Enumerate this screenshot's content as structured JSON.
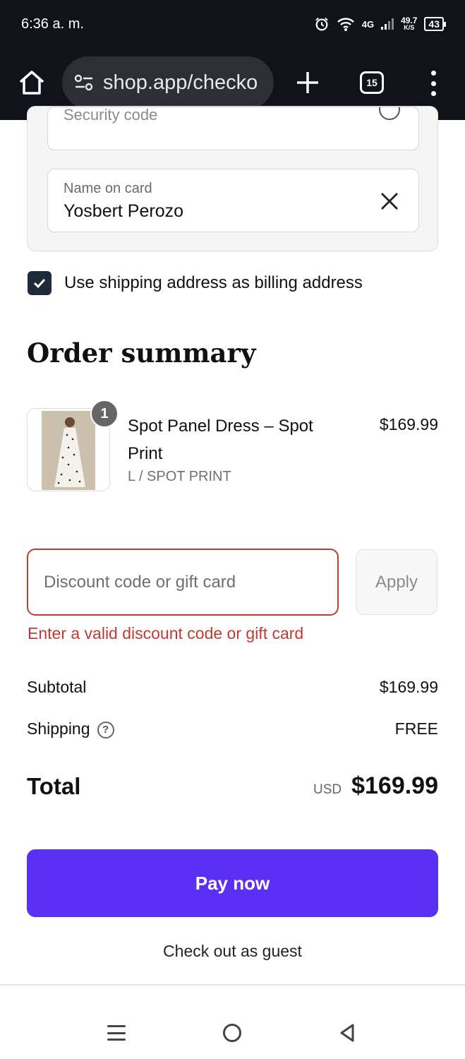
{
  "status_bar": {
    "time": "6:36 a. m.",
    "network": "4G",
    "speed_value": "49.7",
    "speed_unit": "K/S",
    "battery": "43"
  },
  "browser": {
    "url": "shop.app/checko",
    "tab_count": "15"
  },
  "payment": {
    "security_code_placeholder": "Security code",
    "name_label": "Name on card",
    "name_value": "Yosbert Perozo"
  },
  "billing": {
    "checked": true,
    "label": "Use shipping address as billing address"
  },
  "order_summary": {
    "title": "Order summary",
    "items": [
      {
        "quantity": "1",
        "name": "Spot Panel Dress – Spot Print",
        "variant": "L / SPOT PRINT",
        "price": "$169.99"
      }
    ]
  },
  "discount": {
    "placeholder": "Discount code or gift card",
    "value": "",
    "apply_label": "Apply",
    "error": "Enter a valid discount code or gift card"
  },
  "totals": {
    "subtotal_label": "Subtotal",
    "subtotal_value": "$169.99",
    "shipping_label": "Shipping",
    "shipping_value": "FREE",
    "total_label": "Total",
    "currency": "USD",
    "total_value": "$169.99"
  },
  "actions": {
    "pay_label": "Pay now",
    "guest_label": "Check out as guest"
  },
  "colors": {
    "pay_button": "#5a31f4",
    "error": "#c23a31",
    "checkbox": "#1e2a38",
    "browser_chrome": "#10131a"
  },
  "icons": {
    "home": "home-icon",
    "site_settings": "tune-icon",
    "new_tab": "plus-icon",
    "menu": "more-vert-icon",
    "clear": "close-icon",
    "shipping_help": "help-circle-icon"
  }
}
